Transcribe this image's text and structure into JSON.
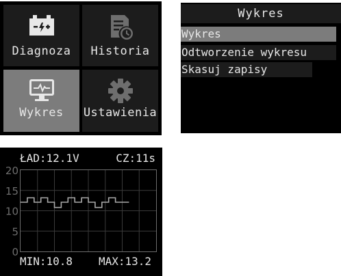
{
  "main_menu": {
    "tiles": [
      {
        "label": "Diagnoza",
        "icon": "battery-icon"
      },
      {
        "label": "Historia",
        "icon": "history-icon"
      },
      {
        "label": "Wykres",
        "icon": "chart-monitor-icon",
        "selected": true
      },
      {
        "label": "Ustawienia",
        "icon": "gear-icon"
      }
    ]
  },
  "chart_menu": {
    "title": "Wykres",
    "items": [
      {
        "label": "Wykres",
        "active": true
      },
      {
        "label": "Odtworzenie wykresu",
        "active": false
      },
      {
        "label": "Skasuj zapisy",
        "active": false
      }
    ]
  },
  "chart_screen": {
    "charge_label": "ŁAD:12.1V",
    "time_label": "CZ:11s",
    "min_label": "MIN:10.8",
    "max_label": "MAX:13.2"
  },
  "chart_data": {
    "type": "line",
    "title": "",
    "xlabel": "",
    "ylabel": "",
    "ylim": [
      0,
      20
    ],
    "yticks": [
      0,
      5,
      10,
      15,
      20
    ],
    "xlim": [
      0,
      20
    ],
    "grid": true,
    "line_color": "#aaaaaa",
    "series": [
      {
        "x": [
          0,
          1,
          1,
          2,
          2,
          3,
          3,
          4,
          4,
          5,
          5,
          6,
          6,
          7,
          7,
          8,
          8,
          9,
          9,
          10,
          10,
          11,
          11,
          12,
          12,
          13,
          13,
          14,
          14,
          15,
          15,
          16
        ],
        "y": [
          12.1,
          12.1,
          13.2,
          13.2,
          12.1,
          12.1,
          13.2,
          13.2,
          12.1,
          12.1,
          10.8,
          10.8,
          12.1,
          12.1,
          13.2,
          13.2,
          12.1,
          12.1,
          13.2,
          13.2,
          12.1,
          12.1,
          10.8,
          10.8,
          12.1,
          12.1,
          13.2,
          13.2,
          12.1,
          12.1,
          12.1,
          12.1
        ]
      }
    ]
  },
  "colors": {
    "screen_bg": "#000000",
    "tile_bg": "#1c1c1c",
    "selected_bg": "#7c7c7c",
    "text": "#e8e8e8"
  }
}
